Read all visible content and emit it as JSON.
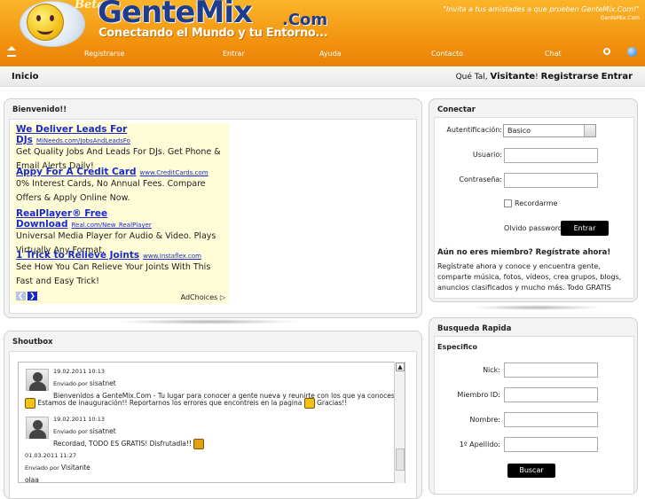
{
  "header": {
    "beta": "Beta",
    "brand": "GenteMix",
    "brand_suffix": ".Com",
    "tagline": "Conectando el Mundo y tu Entorno...",
    "invite": "\"Invita a tus amistades a que prueben GenteMix.Com!\"",
    "invite_sub": "GenteMix.Com"
  },
  "nav": {
    "registrarse": "Registrarse",
    "entrar": "Entrar",
    "ayuda": "Ayuda",
    "contacto": "Contacto",
    "chat": "Chat"
  },
  "subbar": {
    "inicio": "Inicio",
    "greeting": "Qué Tal,",
    "visitor": "Visitante",
    "excl": "!",
    "registrarse": "Registrarse",
    "entrar": "Entrar"
  },
  "bienvenido": {
    "title": "Bienvenido!!",
    "ads": [
      {
        "title": "We Deliver Leads For DJs",
        "url": "MiNeeds.com/JobsAndLeadsFo",
        "desc1": "Get Quality Jobs And Leads For DJs. Get Phone &",
        "desc2": "Email Alerts Daily!"
      },
      {
        "title": "Appy For A Credit Card",
        "url": "www.CreditCards.com",
        "desc1": "0% Interest Cards, No Annual Fees. Compare",
        "desc2": "Offers & Apply Online Now."
      },
      {
        "title": "RealPlayer® Free Download",
        "url": "Real.com/New_RealPlayer",
        "desc1": "Universal Media Player for Audio & Video. Plays",
        "desc2": "Virtually Any Format."
      },
      {
        "title": "1 Trick to Relieve Joints",
        "url": "www.Instaflex.com",
        "desc1": "See How You Can Relieve Your Joints With This",
        "desc2": "Fast and Easy Trick!"
      }
    ],
    "adchoices": "AdChoices ▷"
  },
  "conectar": {
    "title": "Conectar",
    "auth_label": "Autentificación:",
    "auth_value": "Basico",
    "usuario_label": "Usuario:",
    "password_label": "Contraseña:",
    "remember_label": "Recordarme",
    "forgot_label": "Olvido password?",
    "entrar_button": "Entrar",
    "promo_heading": "Aún no eres miembro? Regístrate ahora!",
    "promo_text1": "Regístrate ahora y conoce y encuentra gente,",
    "promo_text2": "comparte música, fotos, vídeos, crea grupos, blogs,",
    "promo_text3": "anuncios clasificados y mucho más. Todo GRATIS"
  },
  "busqueda": {
    "title": "Busqueda Rapida",
    "subtitle": "Especifico",
    "nick_label": "Nick:",
    "member_label": "Miembro ID:",
    "nombre_label": "Nombre:",
    "apellido_label": "1º Apellido:",
    "buscar_button": "Buscar"
  },
  "shoutbox": {
    "title": "Shoutbox",
    "messages": [
      {
        "date": "19.02.2011 10:13",
        "by": "Enviado por",
        "user": "sisatnet",
        "line1": "Bienvenidos a GenteMix.Com - Tu lugar para conocer a gente nueva y reunirte con los que ya conoces",
        "line2a": "Estamos de inauguración!! Reportarnos los errores que encontreis en la pagina",
        "line2b": "Gracias!!"
      },
      {
        "date": "19.02.2011 10:13",
        "by": "Enviado por",
        "user": "sisatnet",
        "line1": "Recordad, TODO ES GRATIS! Disfrutadla!!"
      },
      {
        "date": "01.03.2011 11:27",
        "by": "Enviado por",
        "user": "Visitante",
        "line1": "olaa"
      }
    ]
  },
  "colors": {
    "header_orange": "#f39a12",
    "brand_blue": "#1f3d8a",
    "link_blue": "#1a29cc",
    "ad_bg": "#fffdd8"
  }
}
